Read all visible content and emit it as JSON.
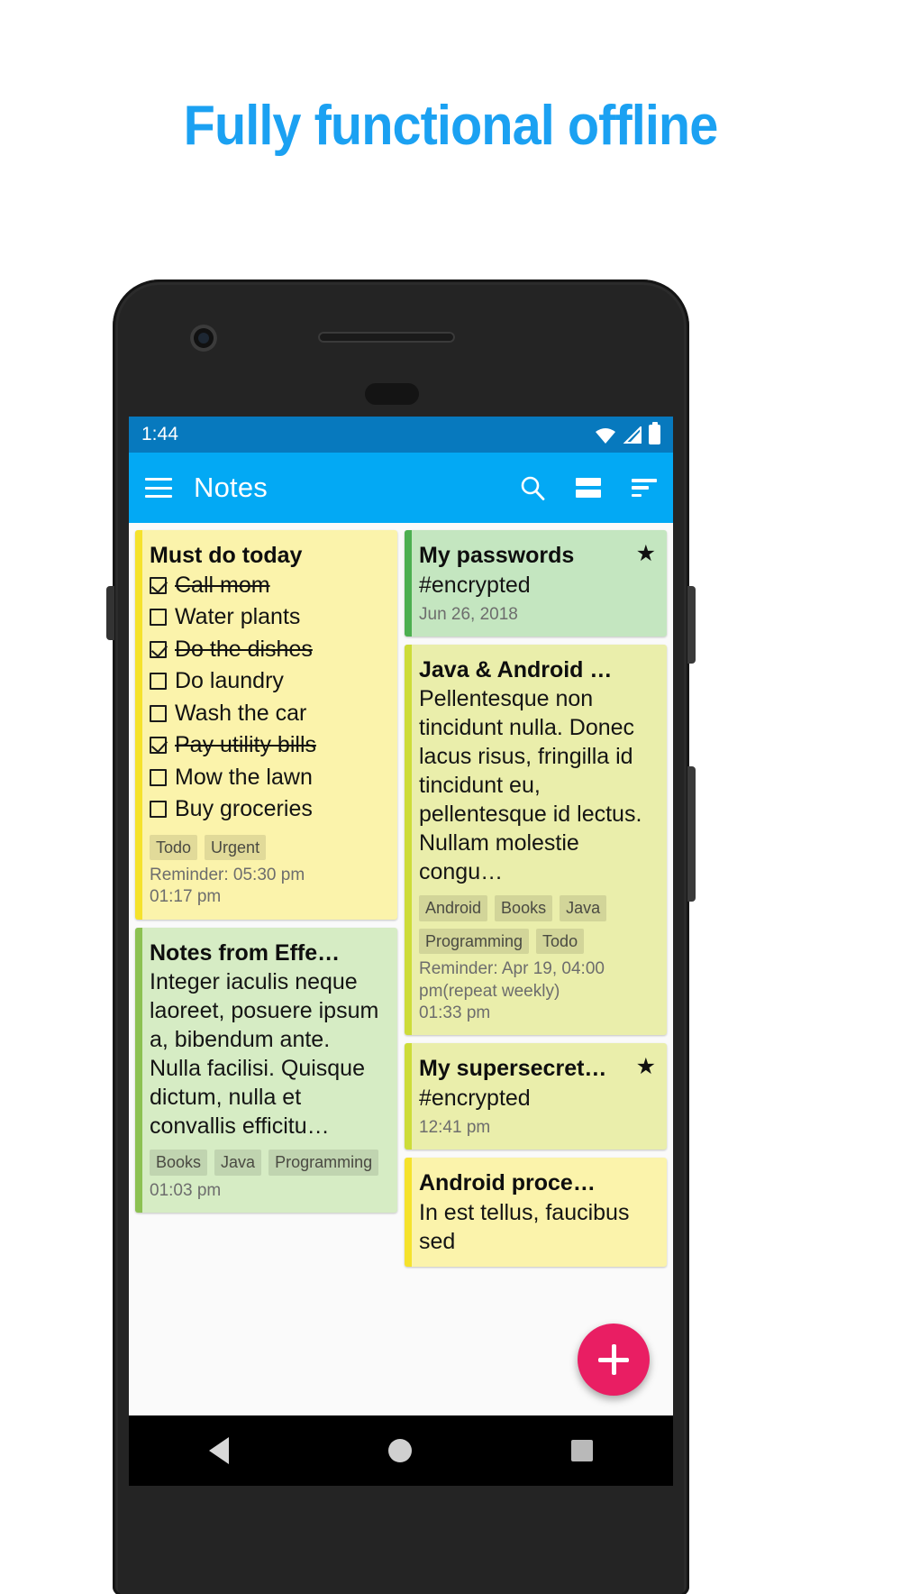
{
  "headline": "Fully functional offline",
  "brand_color": "#1ba1f2",
  "statusbar": {
    "time": "1:44",
    "icons": [
      "wifi-icon",
      "signal-icon",
      "battery-icon"
    ]
  },
  "appbar": {
    "menu_icon": "hamburger-menu-icon",
    "title": "Notes",
    "actions": [
      {
        "icon": "search-icon",
        "label": "Search"
      },
      {
        "icon": "layout-view-icon",
        "label": "Change layout"
      },
      {
        "icon": "sort-icon",
        "label": "Sort"
      }
    ]
  },
  "fab": {
    "icon": "plus-icon",
    "label": "New note",
    "color": "#e91e63"
  },
  "navbar": {
    "items": [
      "back-icon",
      "home-icon",
      "recents-icon"
    ]
  },
  "notes": {
    "left": [
      {
        "id": "must-do-today",
        "title": "Must do today",
        "type": "checklist",
        "bg": "#fbf3ab",
        "stripe": "#f5e22c",
        "items": [
          {
            "text": "Call mom",
            "checked": true
          },
          {
            "text": "Water plants",
            "checked": false
          },
          {
            "text": "Do the dishes",
            "checked": true
          },
          {
            "text": "Do laundry",
            "checked": false
          },
          {
            "text": "Wash the car",
            "checked": false
          },
          {
            "text": "Pay utility bills",
            "checked": true
          },
          {
            "text": "Mow the lawn",
            "checked": false
          },
          {
            "text": "Buy groceries",
            "checked": false
          }
        ],
        "tags": [
          "Todo",
          "Urgent"
        ],
        "reminder": "Reminder: 05:30 pm",
        "date": "01:17 pm",
        "starred": false
      },
      {
        "id": "notes-from-effective-java",
        "title": "Notes from Effe…",
        "type": "text",
        "bg": "#d6ecc4",
        "stripe": "#8cc152",
        "body": "Integer iaculis neque laoreet, posuere ipsum a, bibendum ante. Nulla facilisi. Quisque dictum, nulla et convallis efficitu…",
        "tags": [
          "Books",
          "Java",
          "Programming"
        ],
        "reminder": "",
        "date": "01:03 pm",
        "starred": false
      }
    ],
    "right": [
      {
        "id": "my-passwords",
        "title": "My passwords",
        "type": "text",
        "bg": "#c4e6c0",
        "stripe": "#4caf50",
        "body": "#encrypted",
        "tags": [],
        "reminder": "",
        "date": "Jun 26, 2018",
        "starred": true
      },
      {
        "id": "java-and-android",
        "title": "Java & Android …",
        "type": "text",
        "bg": "#eaeeab",
        "stripe": "#cddc39",
        "body": "Pellentesque non tincidunt nulla. Donec lacus risus, fringilla id tincidunt eu, pellentesque id lectus. Nullam molestie congu…",
        "tags": [
          "Android",
          "Books",
          "Java",
          "Programming",
          "Todo"
        ],
        "reminder": "Reminder: Apr 19, 04:00 pm(repeat weekly)",
        "date": "01:33 pm",
        "starred": false
      },
      {
        "id": "my-supersecret",
        "title": "My supersecret…",
        "type": "text",
        "bg": "#eaeeab",
        "stripe": "#cddc39",
        "body": "#encrypted",
        "tags": [],
        "reminder": "",
        "date": "12:41 pm",
        "starred": true
      },
      {
        "id": "android-process",
        "title": "Android proce…",
        "type": "text",
        "bg": "#fbf3ab",
        "stripe": "#f5e22c",
        "body": "In est tellus, faucibus sed",
        "tags": [],
        "reminder": "",
        "date": "",
        "starred": false
      }
    ]
  }
}
